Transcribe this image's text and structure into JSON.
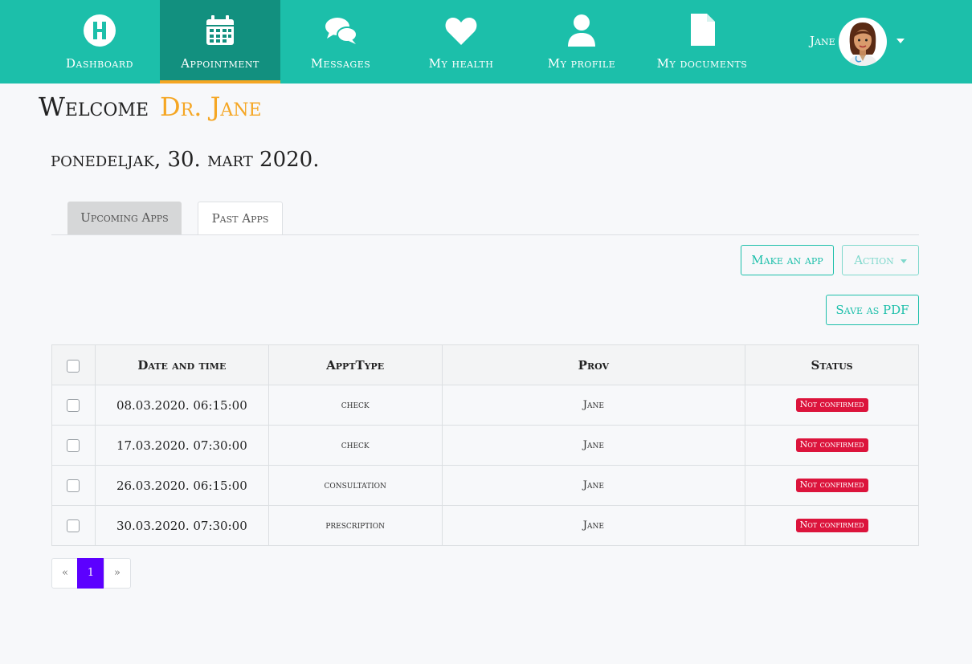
{
  "nav": {
    "items": [
      {
        "label": "Dashboard",
        "icon": "hospital-h-icon"
      },
      {
        "label": "Appointment",
        "icon": "calendar-icon",
        "active": true
      },
      {
        "label": "Messages",
        "icon": "chat-bubbles-icon"
      },
      {
        "label": "My health",
        "icon": "heart-icon"
      },
      {
        "label": "My profile",
        "icon": "user-icon"
      },
      {
        "label": "My documents",
        "icon": "document-icon"
      }
    ],
    "user": {
      "name": "Jane",
      "avatar_icon": "doctor-avatar-icon"
    }
  },
  "welcome": {
    "prefix": "Welcome",
    "name": "Dr. Jane"
  },
  "date": "ponedeljak, 30. mart 2020.",
  "tabs": [
    {
      "label": "Upcoming Apps"
    },
    {
      "label": "Past Apps",
      "active": true
    }
  ],
  "buttons": {
    "make": "Make an app",
    "action": "Action",
    "pdf": "Save as PDF"
  },
  "table": {
    "headers": [
      "Date and time",
      "ApptType",
      "Prov",
      "Status"
    ],
    "rows": [
      {
        "datetime": "08.03.2020. 06:15:00",
        "type": "check",
        "prov": "Jane",
        "status": "Not confirmed"
      },
      {
        "datetime": "17.03.2020. 07:30:00",
        "type": "check",
        "prov": "Jane",
        "status": "Not confirmed"
      },
      {
        "datetime": "26.03.2020. 06:15:00",
        "type": "consultation",
        "prov": "Jane",
        "status": "Not confirmed"
      },
      {
        "datetime": "30.03.2020. 07:30:00",
        "type": "prescription",
        "prov": "Jane",
        "status": "Not confirmed"
      }
    ]
  },
  "pagination": {
    "prev": "«",
    "current": "1",
    "next": "»"
  },
  "colors": {
    "brand": "#1cbfaa",
    "brand_dark": "#12907f",
    "accent": "#f5a623",
    "danger": "#dc143c",
    "page_active": "#5c00ff"
  }
}
